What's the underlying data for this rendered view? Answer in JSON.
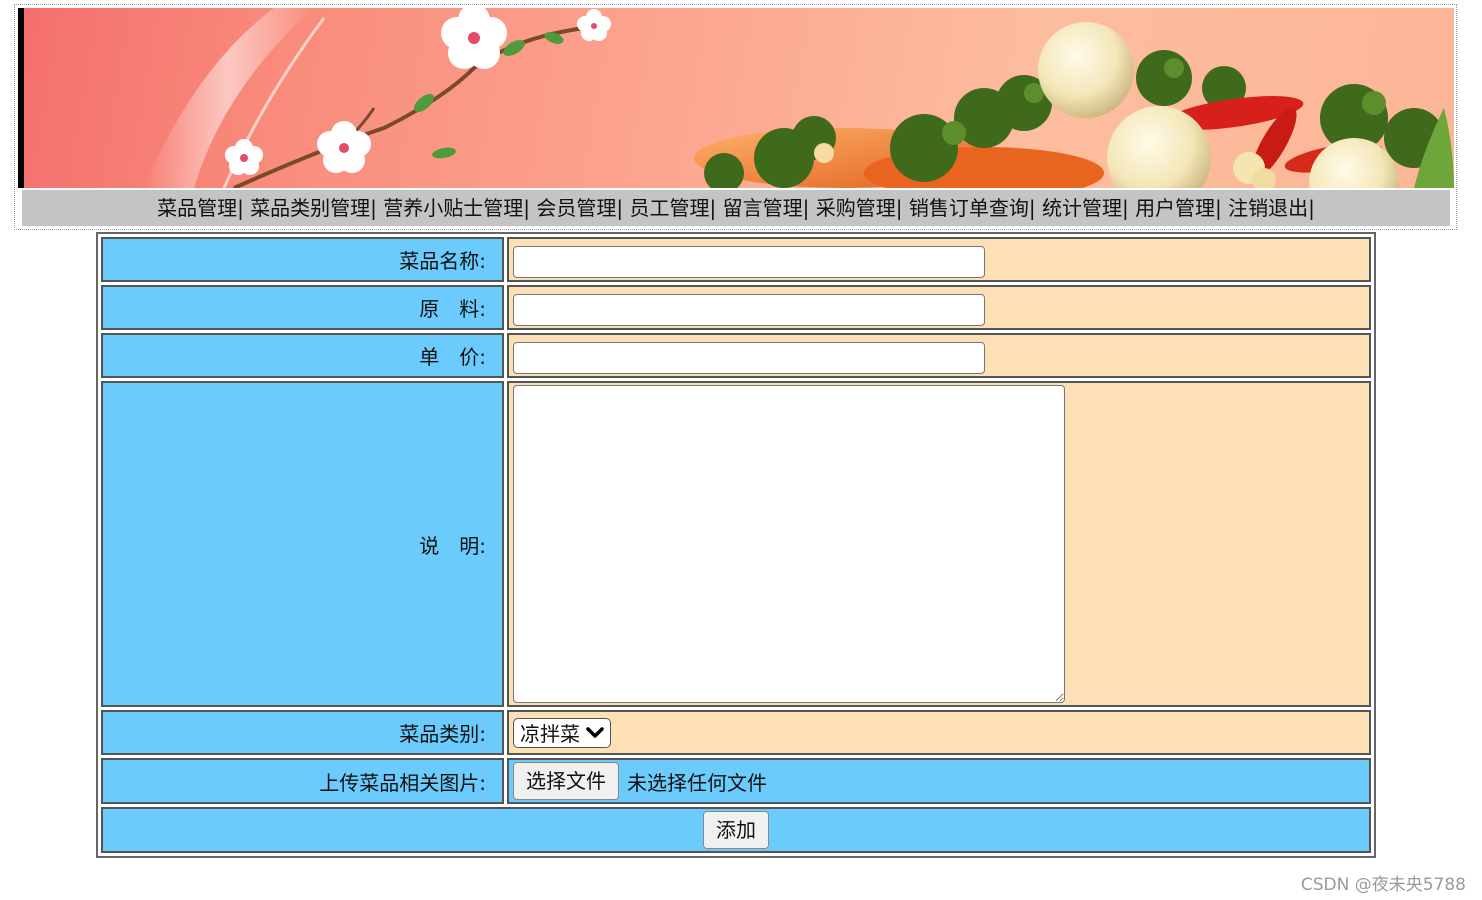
{
  "nav": {
    "items": [
      "菜品管理|",
      "菜品类别管理|",
      "营养小贴士管理|",
      "会员管理|",
      "员工管理|",
      "留言管理|",
      "采购管理|",
      "销售订单查询|",
      "统计管理|",
      "用户管理|",
      "注销退出|"
    ]
  },
  "form": {
    "name_label": "菜品名称:",
    "name_value": "",
    "ingredients_label": "原　料:",
    "ingredients_value": "",
    "price_label": "单　价:",
    "price_value": "",
    "description_label": "说　明:",
    "description_value": "",
    "category_label": "菜品类别:",
    "category_selected": "凉拌菜",
    "upload_label": "上传菜品相关图片:",
    "upload_button": "选择文件",
    "upload_status": "未选择任何文件",
    "submit_label": "添加"
  },
  "colors": {
    "label_bg": "#6ccbfd",
    "field_bg": "#fee0b7",
    "nav_bg": "#c4c4c4"
  },
  "watermark": "CSDN @夜未央5788"
}
